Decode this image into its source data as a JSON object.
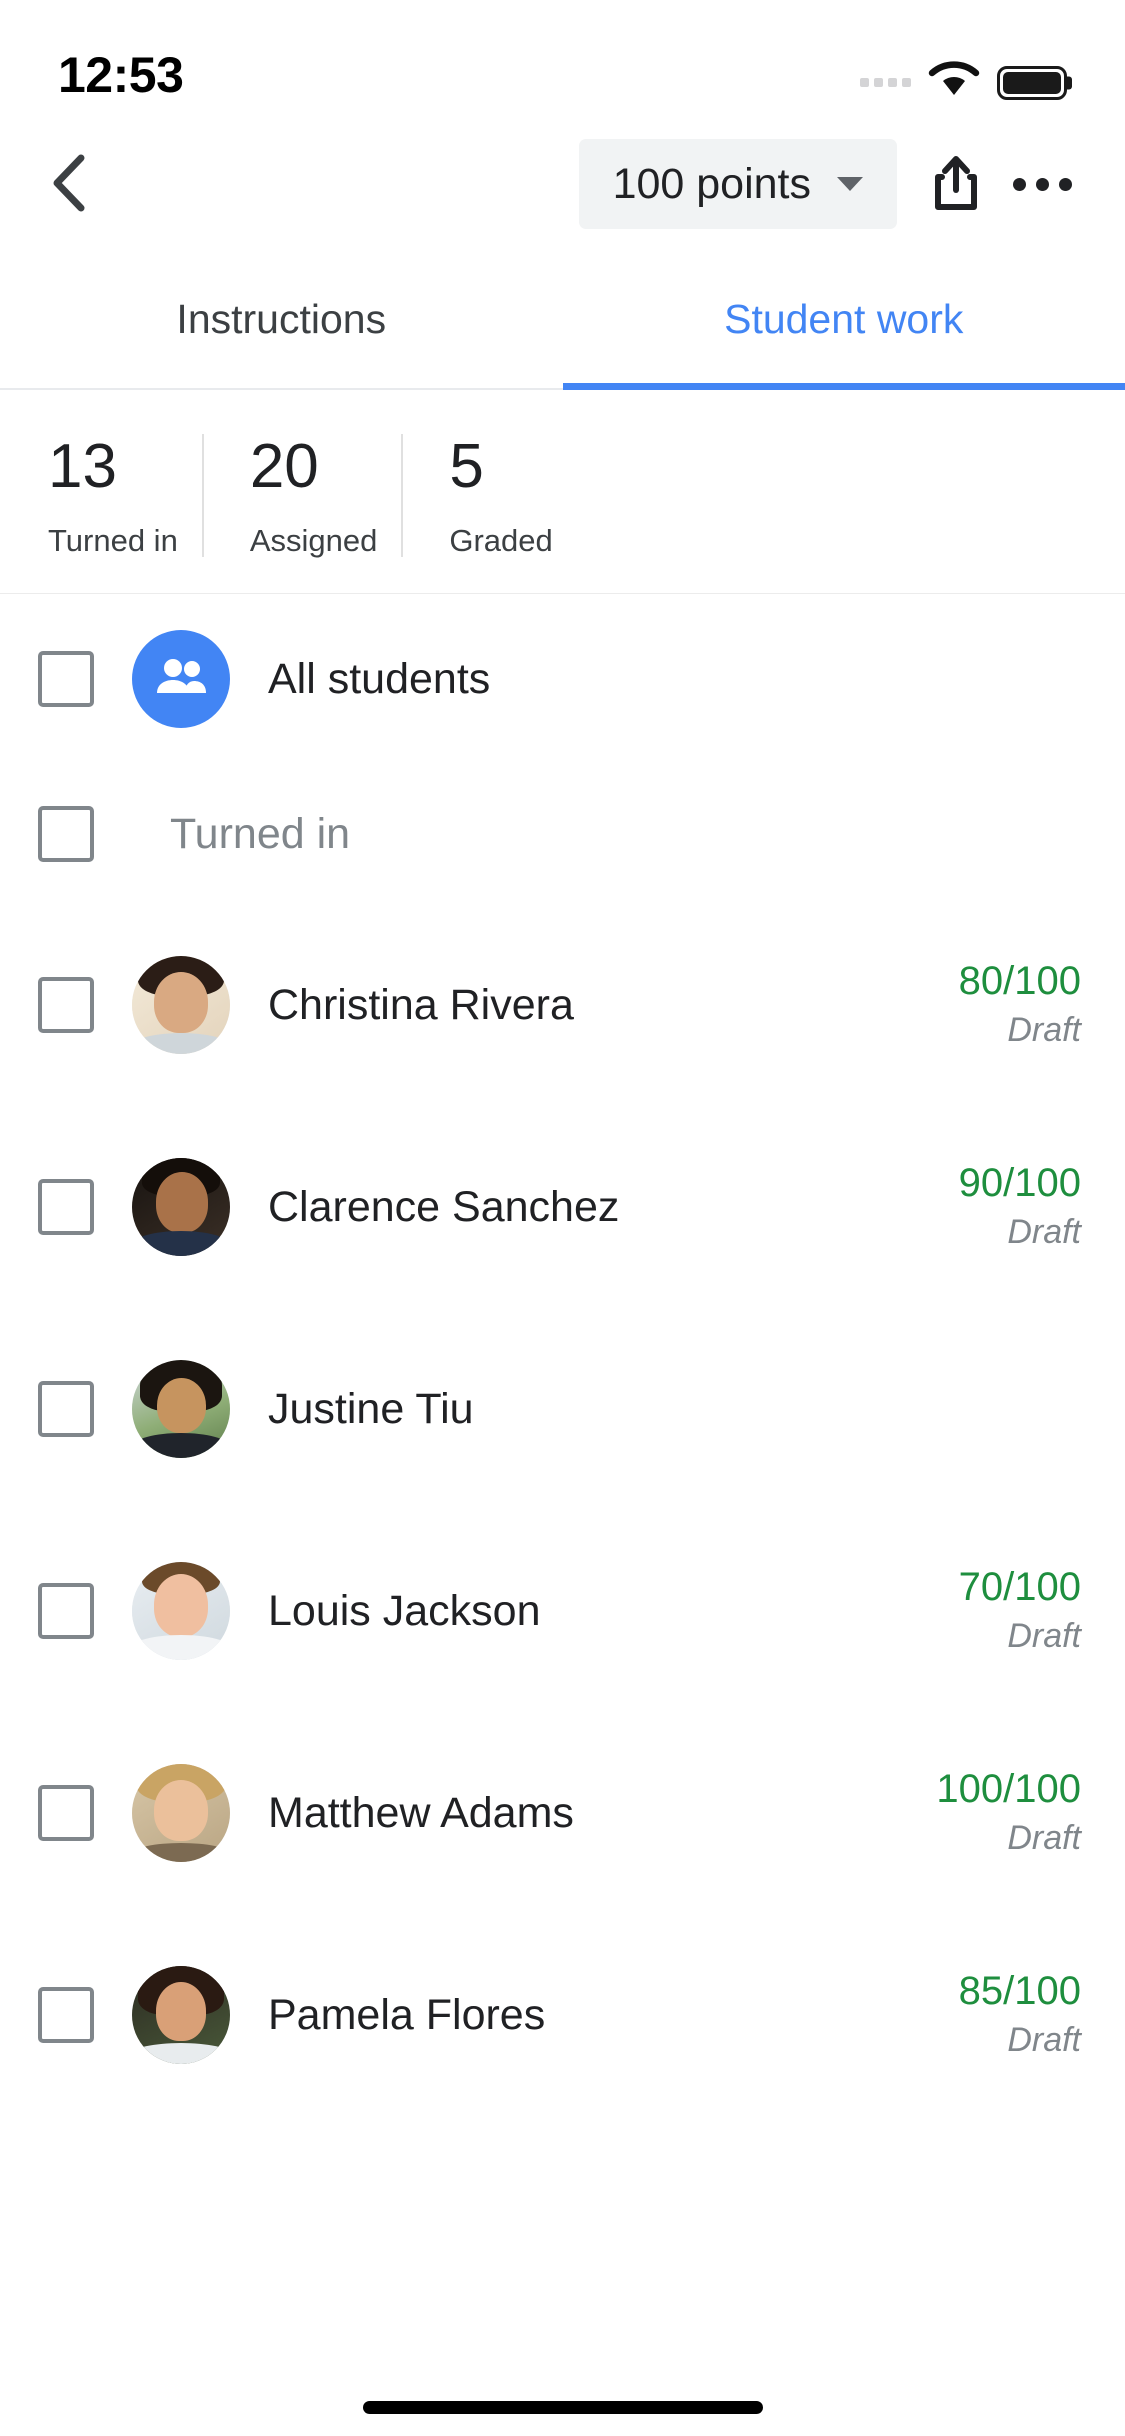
{
  "status_bar": {
    "time": "12:53",
    "signal_icon": "signal-dots-icon",
    "wifi_icon": "wifi-icon",
    "battery_icon": "battery-full-icon"
  },
  "app_bar": {
    "back_icon": "back-chevron-icon",
    "points_label": "100 points",
    "points_caret_icon": "chevron-down-icon",
    "share_icon": "share-icon",
    "overflow_icon": "more-options-icon"
  },
  "tabs": [
    {
      "label": "Instructions",
      "active": false
    },
    {
      "label": "Student work",
      "active": true
    }
  ],
  "stats": [
    {
      "value": "13",
      "label": "Turned in"
    },
    {
      "value": "20",
      "label": "Assigned"
    },
    {
      "value": "5",
      "label": "Graded"
    }
  ],
  "all_students": {
    "label": "All students",
    "avatar_icon": "people-group-icon"
  },
  "section": {
    "label": "Turned in"
  },
  "students": [
    {
      "name": "Christina Rivera",
      "score": "80/100",
      "state": "Draft"
    },
    {
      "name": "Clarence Sanchez",
      "score": "90/100",
      "state": "Draft"
    },
    {
      "name": "Justine Tiu",
      "score": "",
      "state": ""
    },
    {
      "name": "Louis Jackson",
      "score": "70/100",
      "state": "Draft"
    },
    {
      "name": "Matthew Adams",
      "score": "100/100",
      "state": "Draft"
    },
    {
      "name": "Pamela Flores",
      "score": "85/100",
      "state": "Draft"
    }
  ],
  "colors": {
    "accent_blue": "#4285f4",
    "grade_green": "#1e8e3e",
    "muted_gray": "#80868b",
    "chip_bg": "#f1f3f4",
    "text_primary": "#202124"
  }
}
